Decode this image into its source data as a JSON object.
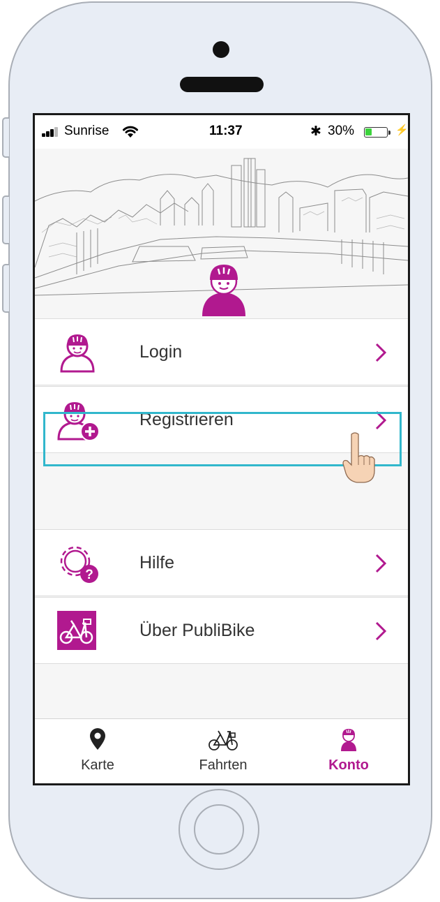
{
  "status_bar": {
    "carrier": "Sunrise",
    "time": "11:37",
    "battery_percent": "30%",
    "bluetooth_icon": "bluetooth-icon",
    "wifi_icon": "wifi-icon"
  },
  "menu": {
    "items": [
      {
        "label": "Login",
        "icon": "user-helmet-icon"
      },
      {
        "label": "Registrieren",
        "icon": "user-add-icon"
      },
      {
        "label": "Hilfe",
        "icon": "gear-help-icon"
      },
      {
        "label": "Über PubliBike",
        "icon": "bike-icon"
      }
    ]
  },
  "tabs": [
    {
      "label": "Karte",
      "icon": "map-pin-icon"
    },
    {
      "label": "Fahrten",
      "icon": "bike-icon"
    },
    {
      "label": "Konto",
      "icon": "user-helmet-icon",
      "active": true
    }
  ],
  "colors": {
    "brand": "#b1198f",
    "highlight": "#31b7cc",
    "battery": "#3cd33c"
  }
}
